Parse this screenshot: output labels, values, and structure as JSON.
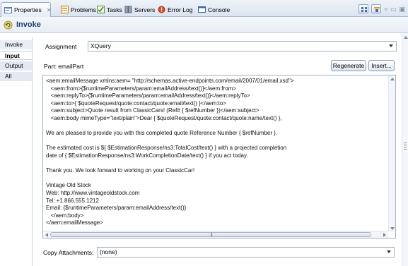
{
  "tabs": [
    {
      "label": "Properties",
      "icon": "properties-icon",
      "active": true
    },
    {
      "label": "Problems",
      "icon": "problems-icon"
    },
    {
      "label": "Tasks",
      "icon": "tasks-icon"
    },
    {
      "label": "Servers",
      "icon": "servers-icon"
    },
    {
      "label": "Error Log",
      "icon": "error-log-icon"
    },
    {
      "label": "Console",
      "icon": "console-icon"
    }
  ],
  "panel": {
    "title": "Invoke",
    "icon": "invoke-icon"
  },
  "nav": [
    {
      "label": "Invoke"
    },
    {
      "label": "Input",
      "active": true
    },
    {
      "label": "Output"
    },
    {
      "label": "All"
    }
  ],
  "assignment": {
    "label": "Assignment",
    "value": "XQuery"
  },
  "part": {
    "label": "Part: emailPart"
  },
  "buttons": {
    "regenerate": "Regenerate",
    "insert": "Insert..."
  },
  "code": {
    "lines": [
      "<aem:emailMessage xmlns:aem= \"http://schemas.active-endpoints.com/email/2007/01/email.xsd\">",
      "   <aem:from>{$runtimeParameters/param:emailAddress/text()}</aem:from>",
      "   <aem:replyTo>{$runtimeParameters/param:emailAddress/text()}</aem:replyTo>",
      "   <aem:to>{ $quoteRequest/quote:contact/quote:email/text() }</aem:to>",
      "   <aem:subject>Quote result from ClassicCars! (Ref# { $refNumber })</aem:subject>",
      "   <aem:body mimeType=\"text/plain\">Dear { $quoteRequest/quote:contact/quote:name/text() },",
      "",
      "We are pleased to provide you with this completed quote Reference Number { $refNumber }.",
      "",
      "The estimated cost is ${ $EstimationResponse/ns3:TotalCost/text() } with a projected completion",
      "date of { $EstimationResponse/ns3:WorkCompletionDate/text() } if you act today.",
      "",
      "Thank you. We look forward to working on your ClassicCar!",
      "",
      "Vintage Old Stock",
      "Web: http://www.vintageoldstock.com",
      "Tel: +1.866.555.1212",
      "Email: {$runtimeParameters/param:emailAddress/text()}",
      "   </aem:body>",
      "</aem:emailMessage>"
    ]
  },
  "copy_attachments": {
    "label": "Copy Attachments:",
    "value": "(none)"
  },
  "colors": {
    "tab_bg": "#dbe4ef",
    "title_text": "#1d3f73",
    "border": "#9fb0c5"
  }
}
